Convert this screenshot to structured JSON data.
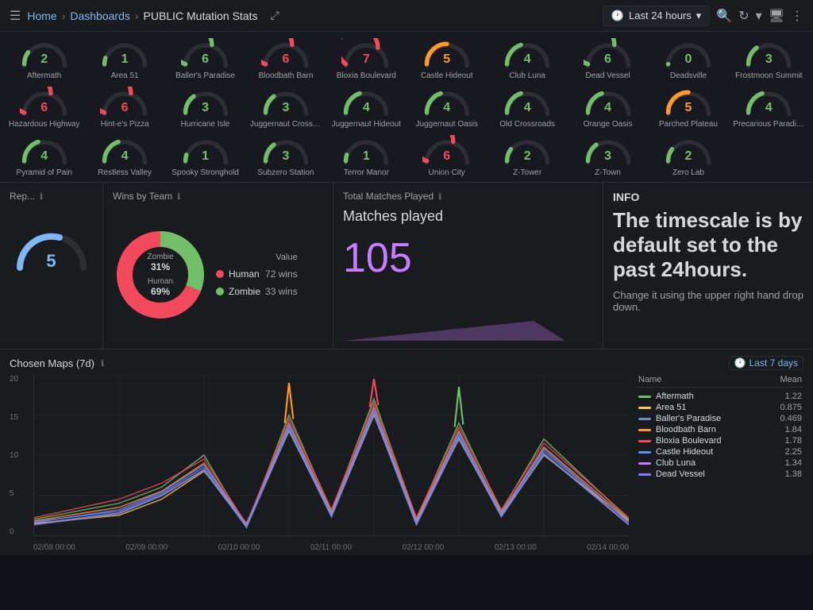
{
  "nav": {
    "hamburger": "☰",
    "breadcrumbs": [
      "Home",
      "Dashboards",
      "PUBLIC Mutation Stats"
    ],
    "share_label": "⤢",
    "time_icon": "🕐",
    "time_label": "Last 24 hours",
    "chevron": "▾",
    "zoom_out": "🔍",
    "refresh": "↻",
    "screen_icon": "🖥",
    "more": "⋮"
  },
  "gauge_rows": [
    [
      {
        "label": "Aftermath",
        "value": "2",
        "color": "#73bf69"
      },
      {
        "label": "Area 51",
        "value": "1",
        "color": "#73bf69"
      },
      {
        "label": "Baller's Paradise",
        "value": "6",
        "color": "#73bf69"
      },
      {
        "label": "Bloodbath Barn",
        "value": "6",
        "color": "#f2495c"
      },
      {
        "label": "Bloxia Boulevard",
        "value": "7",
        "color": "#f2495c"
      },
      {
        "label": "Castle Hideout",
        "value": "5",
        "color": "#ff9830"
      },
      {
        "label": "Club Luna",
        "value": "4",
        "color": "#73bf69"
      },
      {
        "label": "Dead Vessel",
        "value": "6",
        "color": "#73bf69"
      },
      {
        "label": "Deadsville",
        "value": "0",
        "color": "#73bf69"
      },
      {
        "label": "Frostmoon Summit",
        "value": "3",
        "color": "#73bf69"
      }
    ],
    [
      {
        "label": "Hazardous Highway",
        "value": "6",
        "color": "#f2495c"
      },
      {
        "label": "Hint-e's Pizza",
        "value": "6",
        "color": "#f2495c"
      },
      {
        "label": "Hurricane Isle",
        "value": "3",
        "color": "#73bf69"
      },
      {
        "label": "Juggernaut Crossr...",
        "value": "3",
        "color": "#73bf69"
      },
      {
        "label": "Juggernaut Hideout",
        "value": "4",
        "color": "#73bf69"
      },
      {
        "label": "Juggernaut Oasis",
        "value": "4",
        "color": "#73bf69"
      },
      {
        "label": "Old Crossroads",
        "value": "4",
        "color": "#73bf69"
      },
      {
        "label": "Orange Oasis",
        "value": "4",
        "color": "#73bf69"
      },
      {
        "label": "Parched Plateau",
        "value": "5",
        "color": "#ff9830"
      },
      {
        "label": "Precarious Paradise",
        "value": "4",
        "color": "#73bf69"
      }
    ],
    [
      {
        "label": "Pyramid of Pain",
        "value": "4",
        "color": "#73bf69"
      },
      {
        "label": "Restless Valley",
        "value": "4",
        "color": "#73bf69"
      },
      {
        "label": "Spooky Stronghold",
        "value": "1",
        "color": "#73bf69"
      },
      {
        "label": "Subzero Station",
        "value": "3",
        "color": "#73bf69"
      },
      {
        "label": "Terror Manor",
        "value": "1",
        "color": "#73bf69"
      },
      {
        "label": "Union City",
        "value": "6",
        "color": "#f2495c"
      },
      {
        "label": "Z-Tower",
        "value": "2",
        "color": "#73bf69"
      },
      {
        "label": "Z-Town",
        "value": "3",
        "color": "#73bf69"
      },
      {
        "label": "Zero Lab",
        "value": "2",
        "color": "#73bf69"
      },
      {
        "label": "",
        "value": "",
        "color": "#333"
      }
    ]
  ],
  "panels": {
    "rep": {
      "title": "Rep...",
      "value": "5",
      "color": "#7eb6f6"
    },
    "wins": {
      "title": "Wins by Team",
      "human_wins": "72 wins",
      "zombie_wins": "33 wins",
      "human_pct": "69%",
      "zombie_pct": "31%",
      "legend_header": "Value",
      "human_label": "Human",
      "zombie_label": "Zombie",
      "human_color": "#f2495c",
      "zombie_color": "#73bf69"
    },
    "matches": {
      "title": "Total Matches Played",
      "label": "Matches played",
      "value": "105",
      "color": "#c77dff"
    },
    "info": {
      "title": "INFO",
      "heading": "The timescale is by default set to the past 24hours.",
      "body": "Change it using the upper right hand drop down."
    }
  },
  "chart": {
    "title": "Chosen Maps (7d)",
    "badge_label": "Last 7 days",
    "y_labels": [
      "20",
      "15",
      "10",
      "5",
      "0"
    ],
    "x_labels": [
      "02/08 00:00",
      "02/09 00:00",
      "02/10 00:00",
      "02/11 00:00",
      "02/12 00:00",
      "02/13 00:00",
      "02/14 00:00"
    ],
    "legend": [
      {
        "name": "Aftermath",
        "color": "#73bf69",
        "mean": "1.22"
      },
      {
        "name": "Area 51",
        "color": "#f6c85f",
        "mean": "0.875"
      },
      {
        "name": "Baller's Paradise",
        "color": "#6c8ebf",
        "mean": "0.469"
      },
      {
        "name": "Bloodbath Barn",
        "color": "#ff9830",
        "mean": "1.84"
      },
      {
        "name": "Bloxia Boulevard",
        "color": "#f2495c",
        "mean": "1.78"
      },
      {
        "name": "Castle Hideout",
        "color": "#5794f2",
        "mean": "2.25"
      },
      {
        "name": "Club Luna",
        "color": "#c77dff",
        "mean": "1.34"
      },
      {
        "name": "Dead Vessel",
        "color": "#8080ff",
        "mean": "1.38"
      }
    ]
  }
}
